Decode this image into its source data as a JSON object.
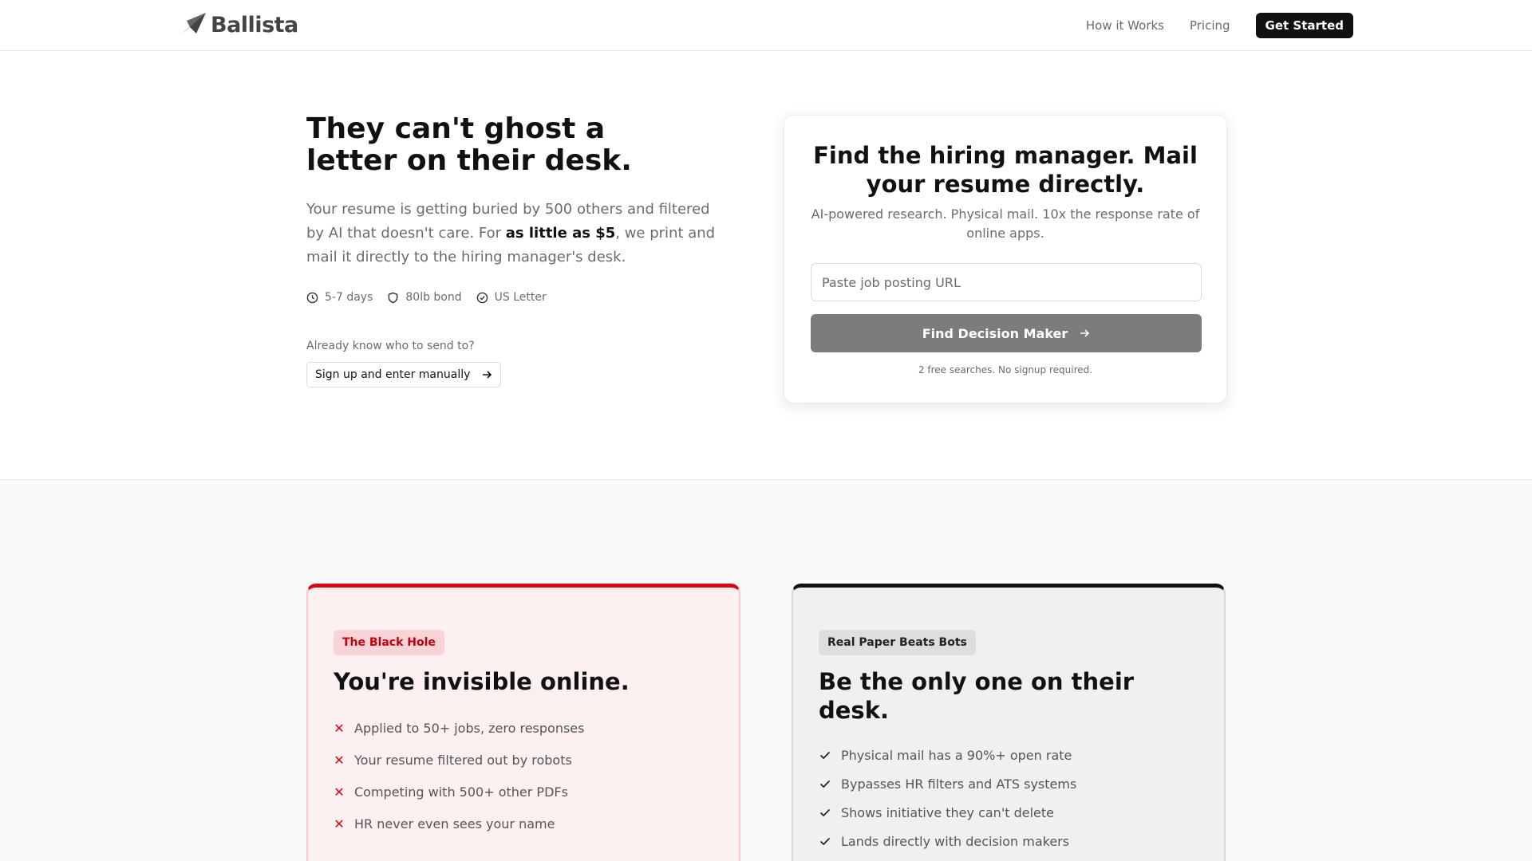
{
  "header": {
    "brand": "Ballista",
    "nav": [
      {
        "label": "How it Works"
      },
      {
        "label": "Pricing"
      }
    ],
    "cta": "Get Started"
  },
  "hero": {
    "title": "They can't ghost a letter on their desk.",
    "desc_prefix": "Your resume is getting buried by 500 others and filtered by AI that doesn't care. For ",
    "desc_strong": "as little as $5",
    "desc_suffix": ", we print and mail it directly to the hiring manager's desk.",
    "features": [
      {
        "icon": "clock-icon",
        "label": "5-7 days"
      },
      {
        "icon": "shield-icon",
        "label": "80lb bond"
      },
      {
        "icon": "check-circle-icon",
        "label": "US Letter"
      }
    ],
    "already_label": "Already know who to send to?",
    "manual_button": "Sign up and enter manually"
  },
  "search_card": {
    "title": "Find the hiring manager. Mail your resume directly.",
    "subtitle": "AI-powered research. Physical mail. 10x the response rate of online apps.",
    "url_placeholder": "Paste job posting URL",
    "url_value": "",
    "button": "Find Decision Maker",
    "note": "2 free searches. No signup required."
  },
  "comparison": {
    "bad": {
      "badge": "The Black Hole",
      "title": "You're invisible online.",
      "items": [
        "Applied to 50+ jobs, zero responses",
        "Your resume filtered out by robots",
        "Competing with 500+ other PDFs",
        "HR never even sees your name"
      ]
    },
    "good": {
      "badge": "Real Paper Beats Bots",
      "title": "Be the only one on their desk.",
      "items": [
        "Physical mail has a 90%+ open rate",
        "Bypasses HR filters and ATS systems",
        "Shows initiative they can't delete",
        "Lands directly with decision makers"
      ]
    }
  },
  "colors": {
    "accent_dark": "#111111",
    "danger": "#d90416",
    "muted_text": "#6b6b6b",
    "button_gray": "#7c7c7c"
  }
}
